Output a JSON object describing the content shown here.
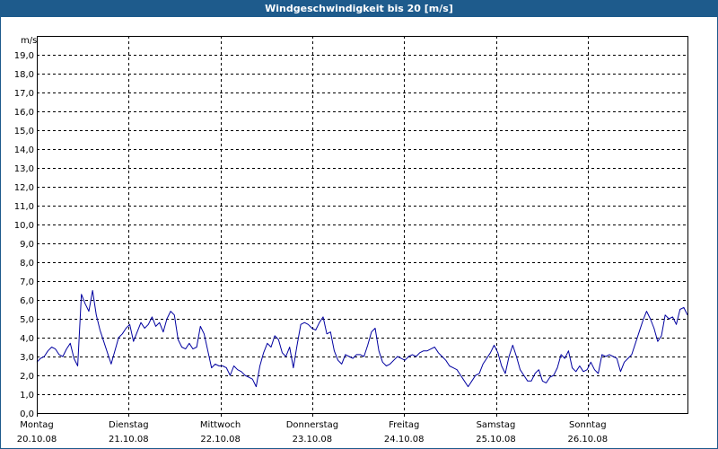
{
  "window": {
    "title": "Windgeschwindigkeit bis 20 [m/s]"
  },
  "colors": {
    "titlebar": "#1e5b8c",
    "line": "#0000a0",
    "grid": "#000000",
    "background": "#ffffff"
  },
  "chart_data": {
    "type": "line",
    "title": "Windgeschwindigkeit bis 20 [m/s]",
    "ylabel": "m/s",
    "xlabel": "",
    "ylim": [
      0,
      20
    ],
    "yticks": [
      "0,0",
      "1,0",
      "2,0",
      "3,0",
      "4,0",
      "5,0",
      "6,0",
      "7,0",
      "8,0",
      "9,0",
      "10,0",
      "11,0",
      "12,0",
      "13,0",
      "14,0",
      "15,0",
      "16,0",
      "17,0",
      "18,0",
      "19,0"
    ],
    "grid": true,
    "x_days": [
      {
        "day": "Montag",
        "date": "20.10.08"
      },
      {
        "day": "Dienstag",
        "date": "21.10.08"
      },
      {
        "day": "Mittwoch",
        "date": "22.10.08"
      },
      {
        "day": "Donnerstag",
        "date": "23.10.08"
      },
      {
        "day": "Freitag",
        "date": "24.10.08"
      },
      {
        "day": "Samstag",
        "date": "25.10.08"
      },
      {
        "day": "Sonntag",
        "date": "26.10.08"
      }
    ],
    "series": [
      {
        "values": [
          2.7,
          2.9,
          3.0,
          3.3,
          3.5,
          3.4,
          3.1,
          3.0,
          3.4,
          3.7,
          2.9,
          2.5,
          6.3,
          5.8,
          5.4,
          6.5,
          5.2,
          4.4,
          3.8,
          3.2,
          2.6,
          3.3,
          4.0,
          4.2,
          4.5,
          4.7,
          3.8,
          4.3,
          4.8,
          4.5,
          4.7,
          5.1,
          4.6,
          4.8,
          4.3,
          5.0,
          5.4,
          5.2,
          3.9,
          3.5,
          3.4,
          3.7,
          3.4,
          3.5,
          4.6,
          4.2,
          3.3,
          2.4,
          2.6,
          2.5,
          2.5,
          2.4,
          2.0,
          2.5,
          2.3,
          2.2,
          2.0,
          1.9,
          1.8,
          1.4,
          2.5,
          3.2,
          3.7,
          3.5,
          4.1,
          3.9,
          3.2,
          3.0,
          3.5,
          2.4,
          3.6,
          4.7,
          4.8,
          4.7,
          4.5,
          4.4,
          4.8,
          5.1,
          4.2,
          4.3,
          3.3,
          2.8,
          2.6,
          3.1,
          3.0,
          2.9,
          3.1,
          3.1,
          3.0,
          3.6,
          4.3,
          4.5,
          3.3,
          2.7,
          2.5,
          2.6,
          2.8,
          3.0,
          2.9,
          2.8,
          3.0,
          3.1,
          3.0,
          3.2,
          3.3,
          3.3,
          3.4,
          3.5,
          3.2,
          3.0,
          2.8,
          2.5,
          2.4,
          2.3,
          2.0,
          1.7,
          1.4,
          1.7,
          2.0,
          2.1,
          2.6,
          2.9,
          3.2,
          3.6,
          3.2,
          2.5,
          2.1,
          3.0,
          3.6,
          3.0,
          2.3,
          2.0,
          1.7,
          1.7,
          2.1,
          2.3,
          1.7,
          1.6,
          1.9,
          2.0,
          2.4,
          3.1,
          2.9,
          3.3,
          2.4,
          2.2,
          2.5,
          2.2,
          2.3,
          2.7,
          2.3,
          2.1,
          3.1,
          3.0,
          3.1,
          3.0,
          2.9,
          2.2,
          2.7,
          2.9,
          3.1,
          3.7,
          4.3,
          4.9,
          5.4,
          5.0,
          4.5,
          3.8,
          4.1,
          5.2,
          5.0,
          5.1,
          4.7,
          5.5,
          5.6,
          5.2
        ]
      }
    ]
  }
}
